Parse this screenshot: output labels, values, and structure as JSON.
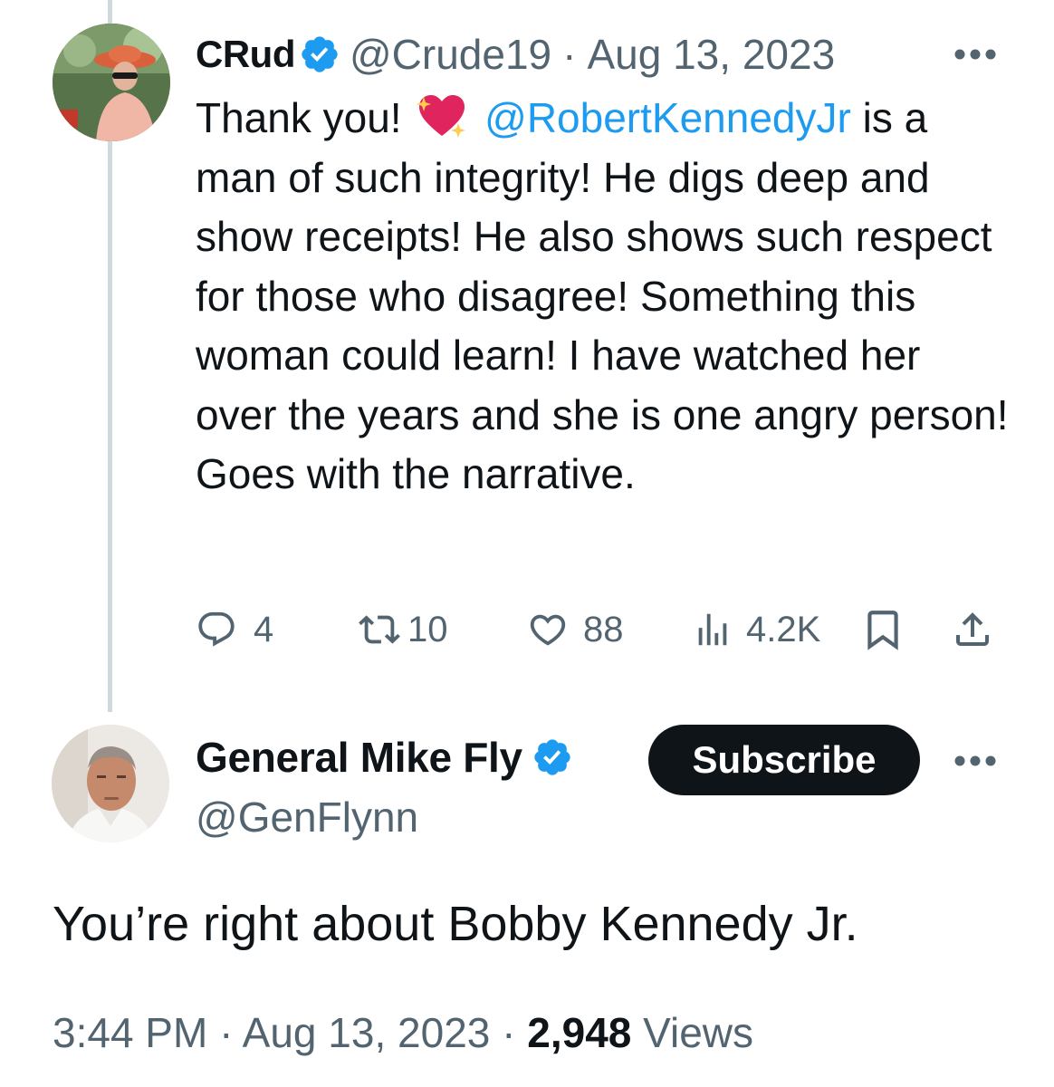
{
  "reply_tweet": {
    "author_name": "CRud",
    "handle": "@Crude19",
    "separator": "·",
    "date": "Aug 13, 2023",
    "text_before_emoji": "Thank you!",
    "emoji": "sparkling-heart-emoji",
    "mention": "@RobertKennedyJr",
    "text_after_mention": " is a man of such integrity! He digs deep and show receipts! He also shows such respect for those who disagree! Something this woman could learn! I have watched her over the years and she is one angry person! Goes with the narrative.",
    "actions": {
      "replies": "4",
      "reposts": "10",
      "likes": "88",
      "views": "4.2K"
    }
  },
  "main_tweet": {
    "author_name": "General Mike Fly",
    "handle": "@GenFlynn",
    "subscribe_label": "Subscribe",
    "text": "You’re right about Bobby Kennedy Jr.",
    "time": "3:44 PM",
    "separator": "·",
    "date": "Aug 13, 2023",
    "views_count": "2,948",
    "views_label": "Views"
  },
  "colors": {
    "text_primary": "#0f1419",
    "text_secondary": "#536471",
    "link_blue": "#1d9bf0",
    "verified_blue": "#1d9bf0",
    "subscribe_bg": "#0f1419",
    "thread_line": "#cfd9de"
  }
}
